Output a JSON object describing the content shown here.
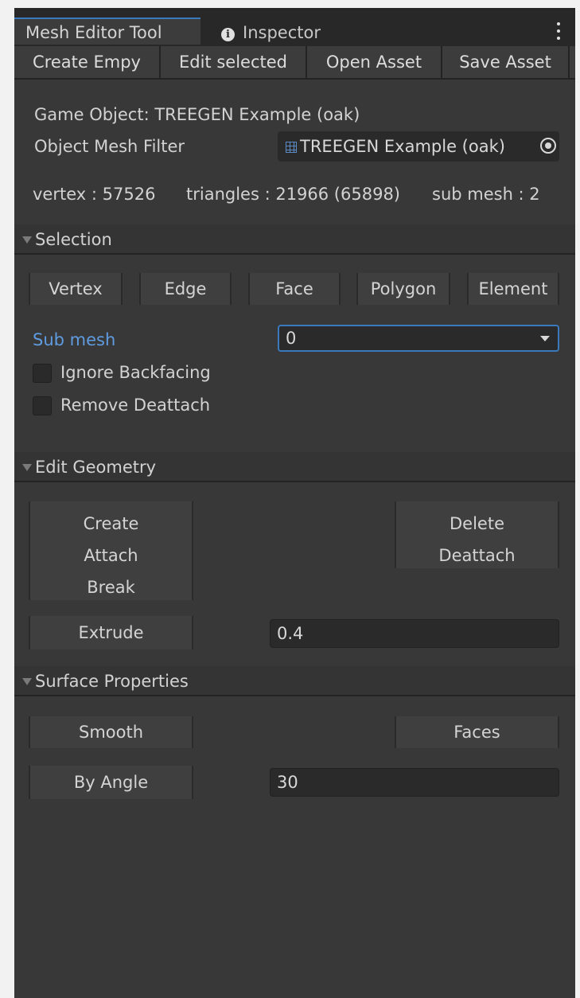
{
  "tabs": {
    "active": "Mesh Editor Tool",
    "inactive": "Inspector"
  },
  "toolbar": {
    "create_empty": "Create Empy",
    "edit_selected": "Edit selected",
    "open_asset": "Open Asset",
    "save_asset": "Save Asset"
  },
  "info": {
    "game_object": "Game Object: TREEGEN Example (oak)",
    "mesh_filter_label": "Object Mesh Filter",
    "mesh_filter_value": "TREEGEN Example (oak)",
    "vertex": "vertex : 57526",
    "triangles": "triangles : 21966 (65898)",
    "sub_mesh": "sub mesh : 2"
  },
  "selection": {
    "header": "Selection",
    "modes": [
      "Vertex",
      "Edge",
      "Face",
      "Polygon",
      "Element"
    ],
    "sub_mesh_label": "Sub mesh",
    "sub_mesh_value": "0",
    "ignore_backfacing": "Ignore Backfacing",
    "remove_deattach": "Remove Deattach"
  },
  "edit_geometry": {
    "header": "Edit Geometry",
    "create": "Create",
    "attach": "Attach",
    "break": "Break",
    "delete": "Delete",
    "deattach": "Deattach",
    "extrude": "Extrude",
    "extrude_value": "0.4"
  },
  "surface": {
    "header": "Surface Properties",
    "smooth": "Smooth",
    "faces": "Faces",
    "by_angle": "By Angle",
    "angle_value": "30"
  },
  "colors": {
    "accent": "#3a79bb",
    "link_label": "#5f9be0",
    "panel": "#383838"
  },
  "icons": [
    "info-icon",
    "menu-dots-icon",
    "mesh-grid-icon",
    "object-picker-icon",
    "foldout-triangle-icon",
    "dropdown-caret-icon"
  ]
}
